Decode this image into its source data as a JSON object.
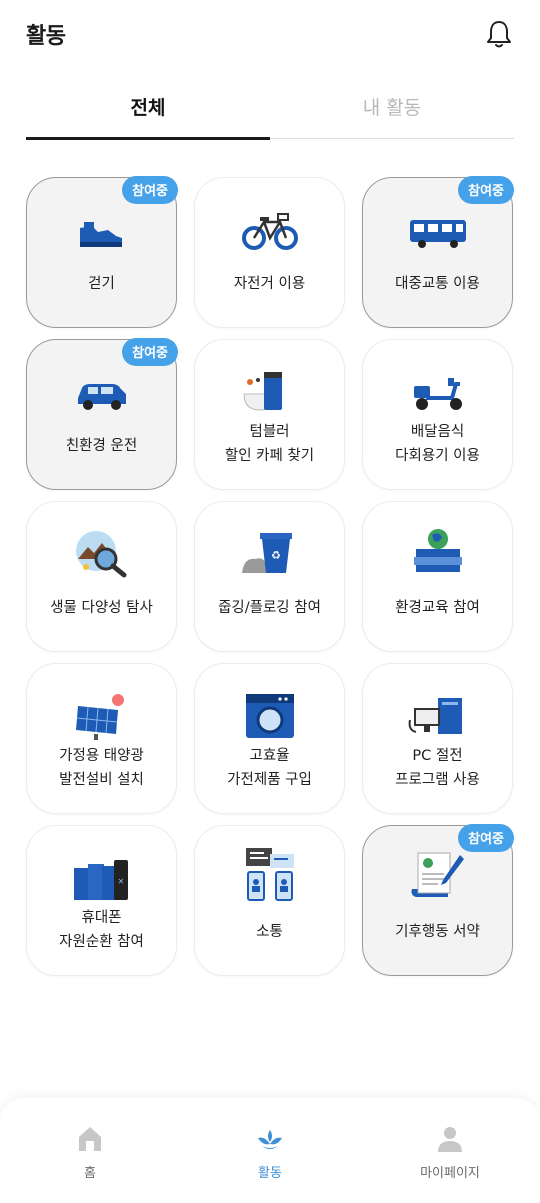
{
  "header": {
    "title": "활동",
    "bell_icon": "bell-icon"
  },
  "tabs": [
    {
      "label": "전체",
      "active": true
    },
    {
      "label": "내 활동",
      "active": false
    }
  ],
  "badge_label": "참여중",
  "activities": [
    {
      "lines": [
        "걷기"
      ],
      "joined": true,
      "icon": "sneaker-icon"
    },
    {
      "lines": [
        "자전거 이용"
      ],
      "joined": false,
      "icon": "bicycle-icon"
    },
    {
      "lines": [
        "대중교통 이용"
      ],
      "joined": true,
      "icon": "bus-icon"
    },
    {
      "lines": [
        "친환경 운전"
      ],
      "joined": true,
      "icon": "car-icon"
    },
    {
      "lines": [
        "텀블러",
        "할인 카페 찾기"
      ],
      "joined": false,
      "icon": "tumbler-icon"
    },
    {
      "lines": [
        "배달음식",
        "다회용기 이용"
      ],
      "joined": false,
      "icon": "delivery-scooter-icon"
    },
    {
      "lines": [
        "생물 다양성 탐사"
      ],
      "joined": false,
      "icon": "magnifier-nature-icon"
    },
    {
      "lines": [
        "줍깅/플로깅 참여"
      ],
      "joined": false,
      "icon": "recycle-bin-icon"
    },
    {
      "lines": [
        "환경교육 참여"
      ],
      "joined": false,
      "icon": "books-globe-icon"
    },
    {
      "lines": [
        "가정용 태양광",
        "발전설비 설치"
      ],
      "joined": false,
      "icon": "solar-panel-icon"
    },
    {
      "lines": [
        "고효율",
        "가전제품 구입"
      ],
      "joined": false,
      "icon": "washing-machine-icon"
    },
    {
      "lines": [
        "PC 절전",
        "프로그램 사용"
      ],
      "joined": false,
      "icon": "computer-icon"
    },
    {
      "lines": [
        "휴대폰",
        "자원순환 참여"
      ],
      "joined": false,
      "icon": "phones-icon"
    },
    {
      "lines": [
        "소통"
      ],
      "joined": false,
      "icon": "chat-icon"
    },
    {
      "lines": [
        "기후행동 서약"
      ],
      "joined": true,
      "icon": "pledge-document-icon"
    }
  ],
  "bottom_nav": [
    {
      "label": "홈",
      "icon": "home-icon",
      "active": false
    },
    {
      "label": "활동",
      "icon": "activity-icon",
      "active": true
    },
    {
      "label": "마이페이지",
      "icon": "person-icon",
      "active": false
    }
  ],
  "colors": {
    "accent": "#46a2e8",
    "nav_active": "#3d8fd6",
    "icon_blue": "#1e5bb5"
  }
}
